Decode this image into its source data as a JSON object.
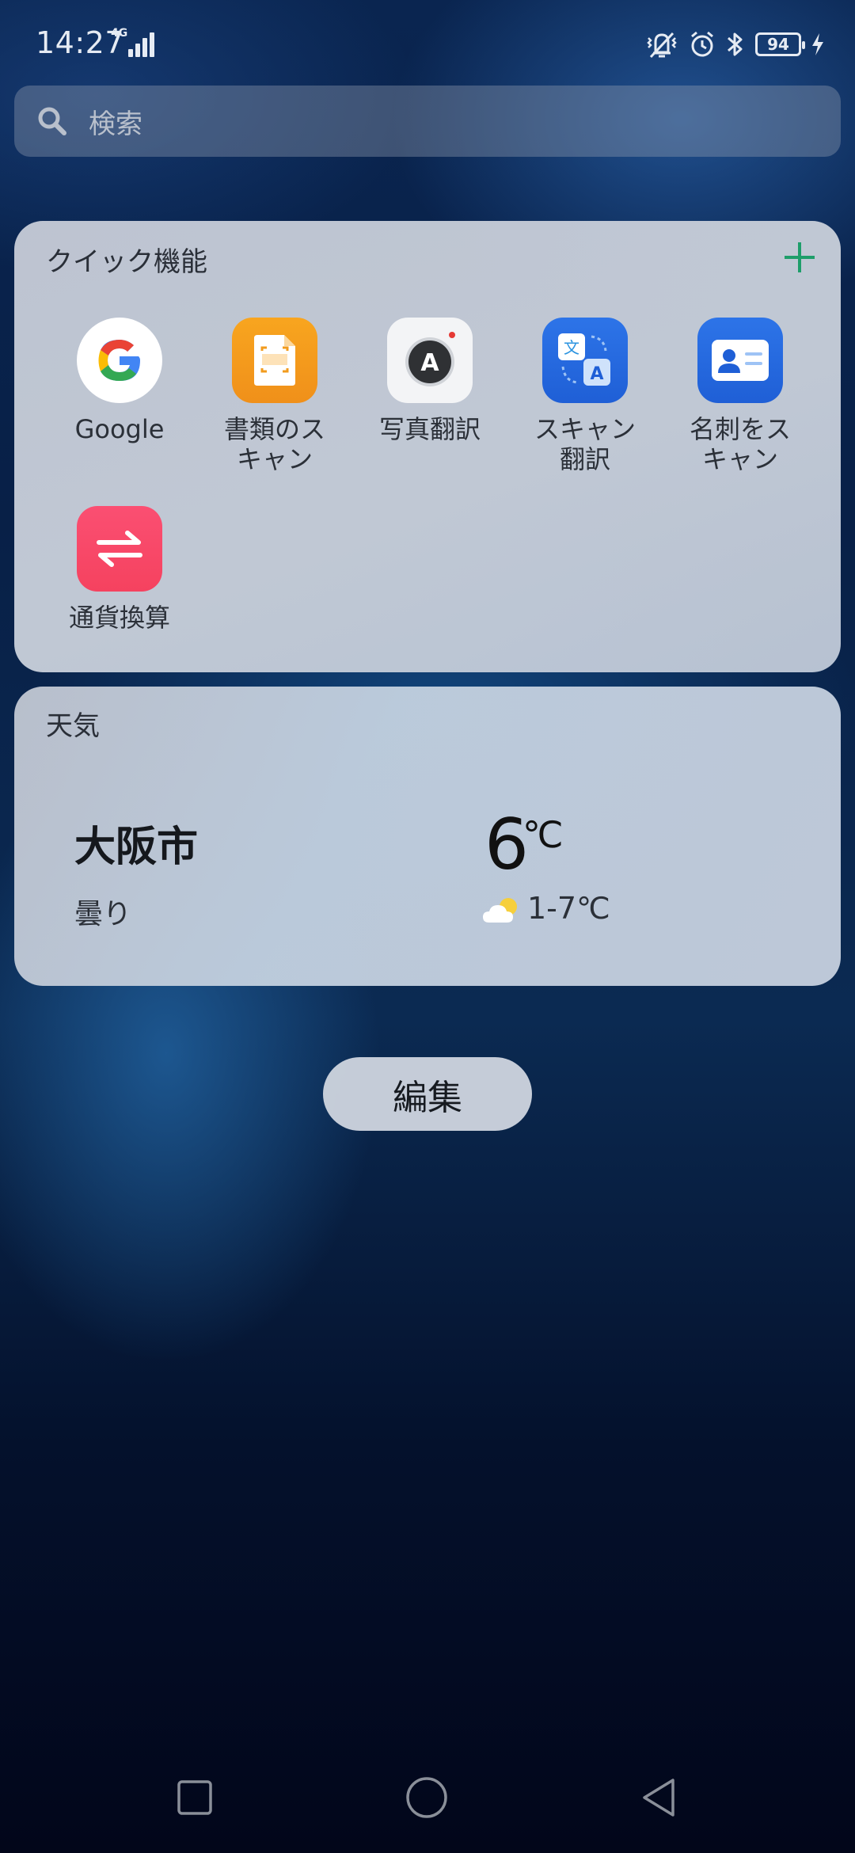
{
  "status": {
    "time": "14:27",
    "network": "4G",
    "battery": "94"
  },
  "search": {
    "placeholder": "検索"
  },
  "quick": {
    "title": "クイック機能",
    "add_icon": "plus-icon",
    "apps": [
      {
        "label": "Google",
        "icon": "google-icon"
      },
      {
        "label": "書類のスキャン",
        "icon": "document-scan-icon"
      },
      {
        "label": "写真翻訳",
        "icon": "photo-translate-icon"
      },
      {
        "label": "スキャン翻訳",
        "icon": "scan-translate-icon"
      },
      {
        "label": "名刺をスキャン",
        "icon": "business-card-scan-icon"
      },
      {
        "label": "通貨換算",
        "icon": "currency-exchange-icon"
      }
    ]
  },
  "weather": {
    "title": "天気",
    "city": "大阪市",
    "condition": "曇り",
    "temp": "6",
    "unit": "℃",
    "range": "1-7℃",
    "icon": "partly-cloudy-icon"
  },
  "edit_label": "編集",
  "nav": {
    "recent": "square-icon",
    "home": "circle-icon",
    "back": "triangle-back-icon"
  },
  "colors": {
    "accent_plus": "#1e9e6a",
    "google_blue": "#4285f4",
    "doc_orange": "#f7a21a",
    "translate_blue": "#2268df",
    "currency_pink": "#f54a6a"
  }
}
